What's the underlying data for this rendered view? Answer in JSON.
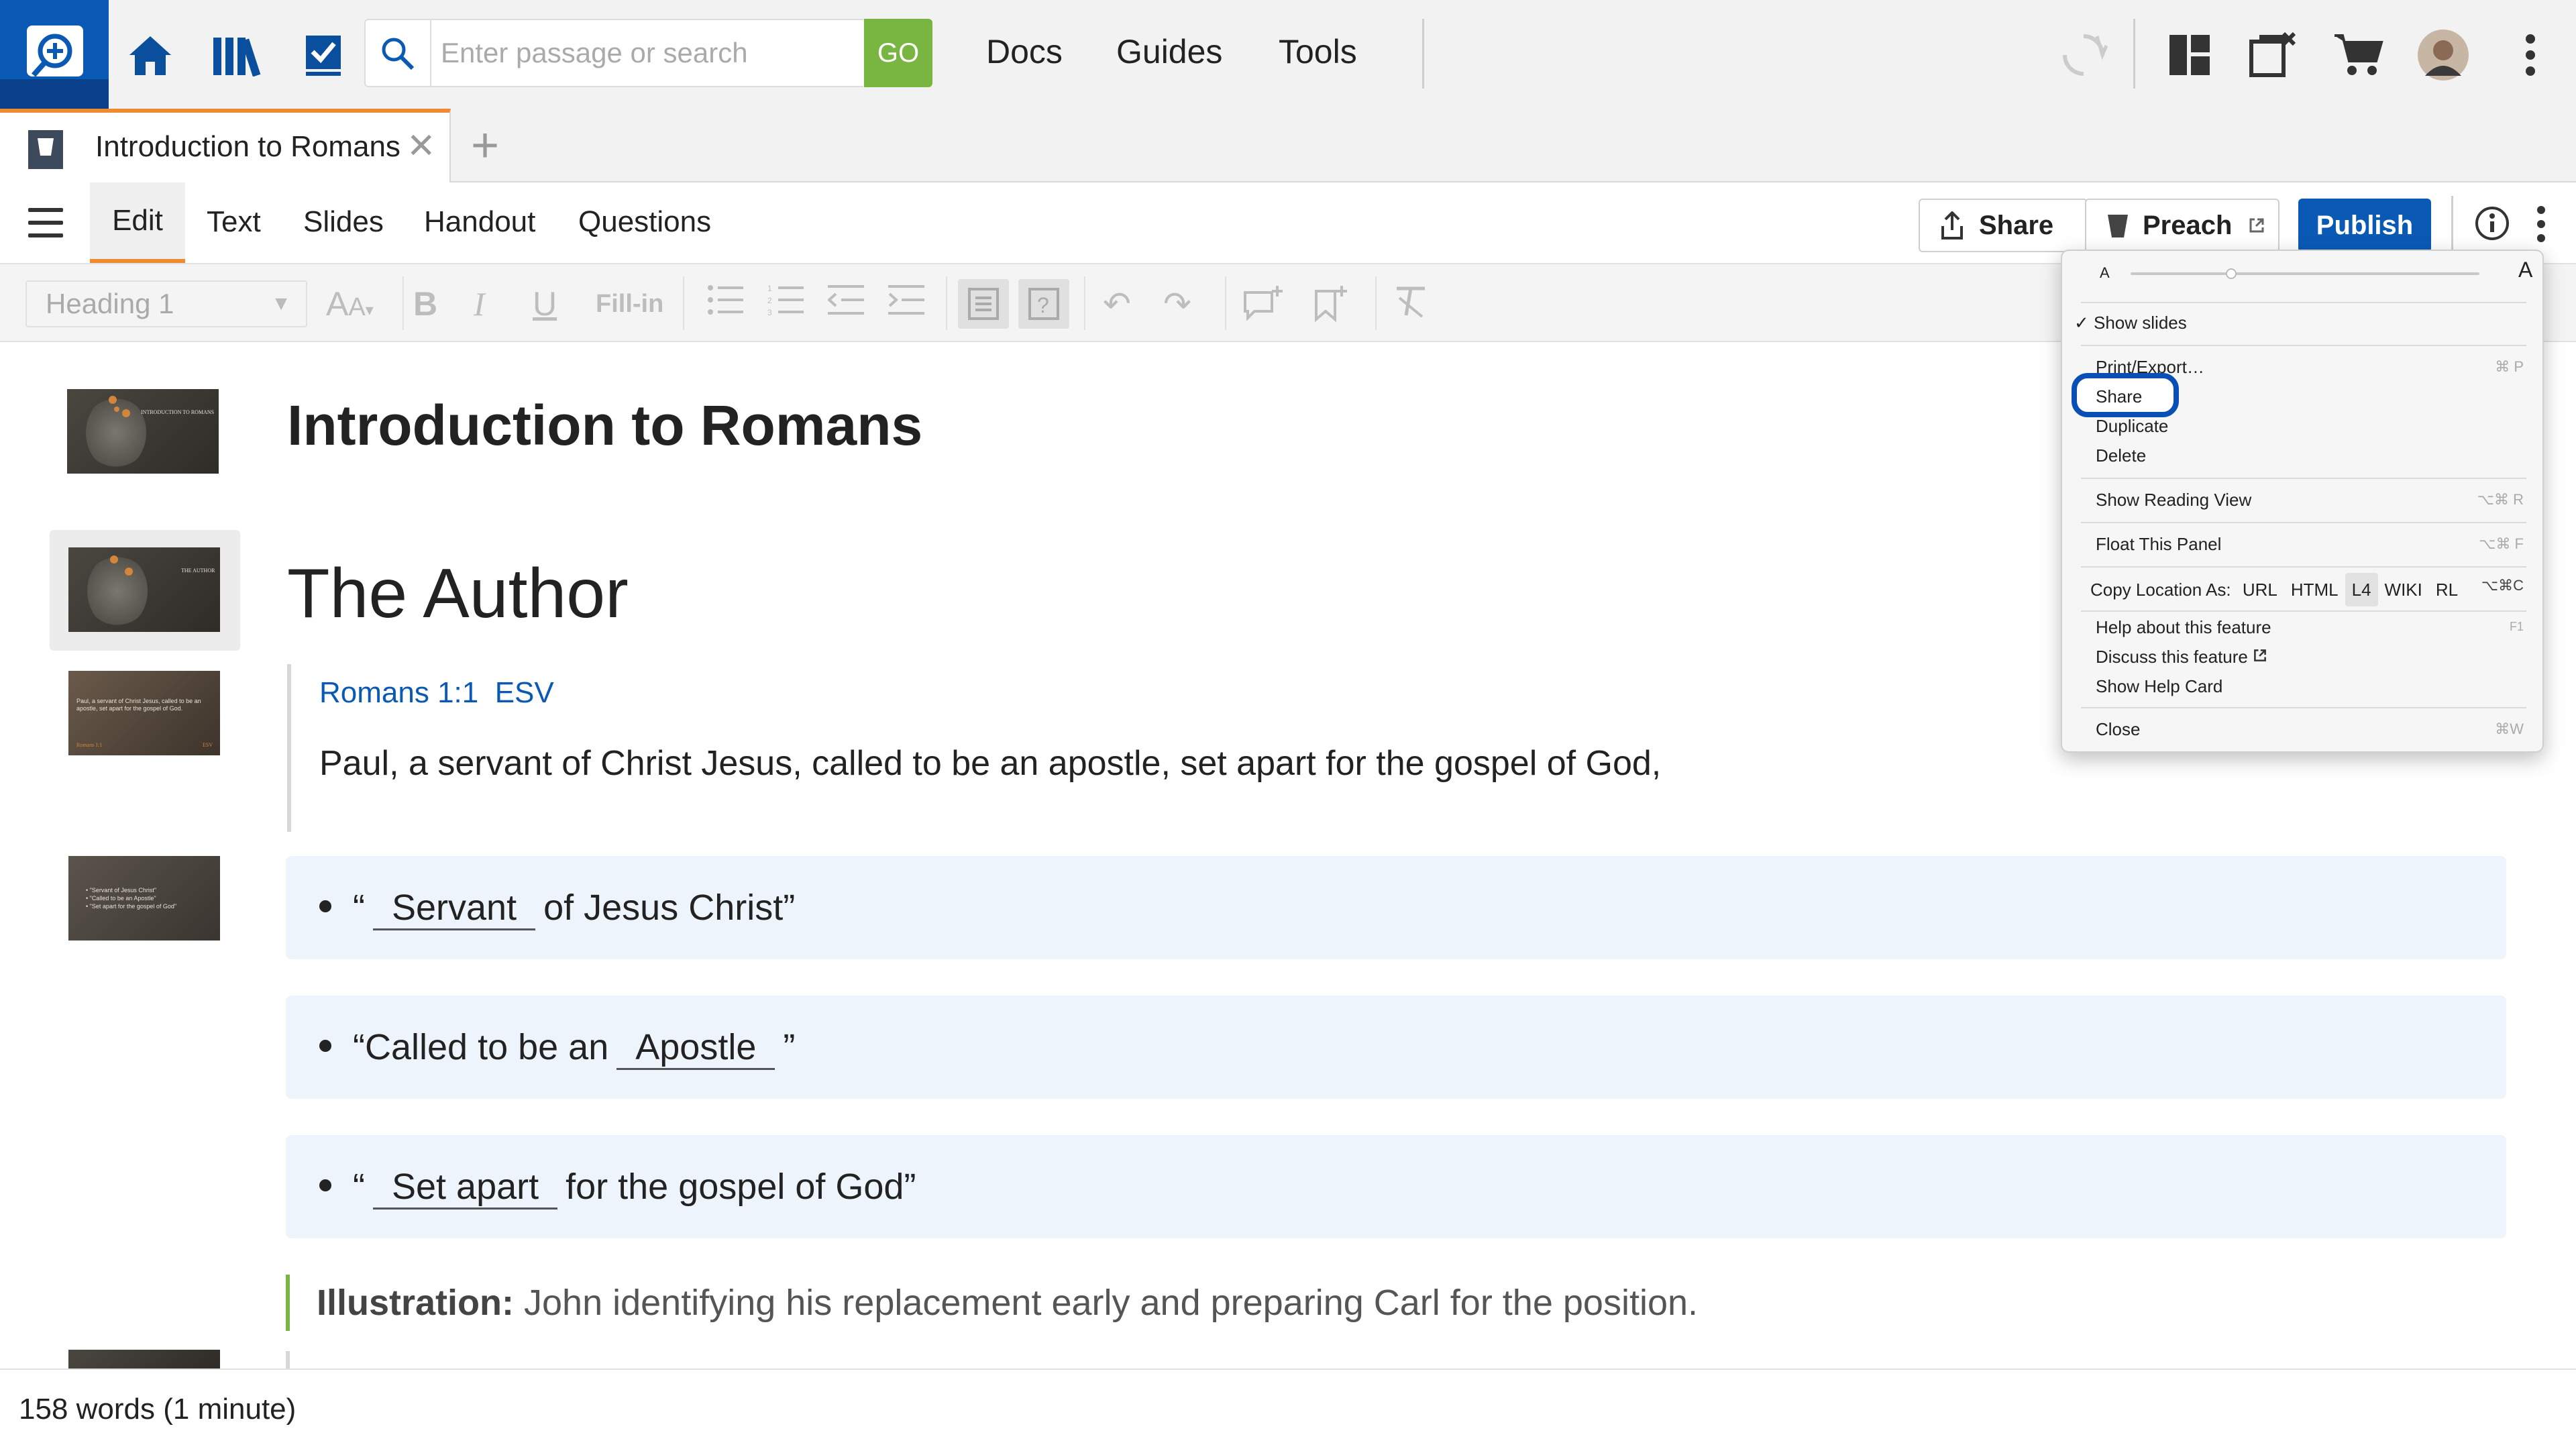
{
  "topbar": {
    "search_placeholder": "Enter passage or search",
    "go_label": "GO",
    "nav": [
      "Docs",
      "Guides",
      "Tools"
    ]
  },
  "tabbar": {
    "tab_title": "Introduction to Romans",
    "new_tab": "+"
  },
  "toolbar": {
    "modes": [
      "Edit",
      "Text",
      "Slides",
      "Handout",
      "Questions"
    ],
    "share_label": "Share",
    "preach_label": "Preach",
    "publish_label": "Publish"
  },
  "format": {
    "style_value": "Heading 1",
    "fill_in_label": "Fill-in"
  },
  "document": {
    "title": "Introduction to Romans",
    "section": "The Author",
    "reference": "Romans 1:1",
    "version": "ESV",
    "verse": "Paul, a servant of Christ Jesus, called to be an apostle, set apart for the gospel of God,",
    "bullets": [
      {
        "pre": "“",
        "blank": "Servant",
        "post": "of Jesus Christ”"
      },
      {
        "pre": "“Called to be an",
        "blank": "Apostle",
        "post": "”"
      },
      {
        "pre": "“",
        "blank": "Set apart",
        "post": "for the gospel of God”"
      }
    ],
    "illustration_label": "Illustration:",
    "illustration_text": "John identifying his replacement early and preparing Carl for the position."
  },
  "thumbs": {
    "t1_text": "INTRODUCTION TO ROMANS",
    "t2_text": "THE AUTHOR",
    "t3_text": "Paul, a servant of Christ Jesus, called to be an apostle, set apart for the gospel of God.",
    "t3_ref": "Romans 1:1",
    "t3_ver": "ESV",
    "t4_lines": [
      "• \"Servant of Jesus Christ\"",
      "• \"Called to be an Apostle\"",
      "• \"Set apart for the gospel of God\""
    ]
  },
  "footer": {
    "wordcount": "158 words (1 minute)"
  },
  "menu": {
    "font_small": "A",
    "font_large": "A",
    "show_slides": "✓ Show slides",
    "print_export": "Print/Export…",
    "print_key": "⌘ P",
    "share": "Share",
    "duplicate": "Duplicate",
    "delete": "Delete",
    "reading_view": "Show Reading View",
    "reading_key": "⌥⌘ R",
    "float_panel": "Float This Panel",
    "float_key": "⌥⌘ F",
    "copy_location": "Copy Location As:",
    "copy_options": [
      "URL",
      "HTML",
      "L4",
      "WIKI",
      "RL"
    ],
    "copy_key": "⌥⌘C",
    "help_feature": "Help about this feature",
    "help_key": "F1",
    "discuss_feature": "Discuss this feature",
    "help_card": "Show Help Card",
    "close": "Close",
    "close_key": "⌘W"
  },
  "colors": {
    "brand_blue": "#0a5ab5",
    "go_green": "#79b541",
    "tab_accent": "#f08a30",
    "highlight": "#0a4fb5"
  }
}
